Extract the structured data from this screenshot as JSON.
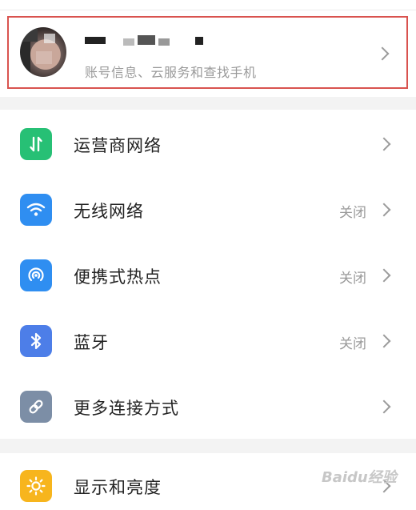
{
  "account": {
    "subtitle": "账号信息、云服务和查找手机"
  },
  "settings": [
    {
      "label": "运营商网络",
      "status": "",
      "icon": "mobile-data-icon",
      "color": "#27c075"
    },
    {
      "label": "无线网络",
      "status": "关闭",
      "icon": "wifi-icon",
      "color": "#2f8ef1"
    },
    {
      "label": "便携式热点",
      "status": "关闭",
      "icon": "hotspot-icon",
      "color": "#2f8ef1"
    },
    {
      "label": "蓝牙",
      "status": "关闭",
      "icon": "bluetooth-icon",
      "color": "#4d7ee8"
    },
    {
      "label": "更多连接方式",
      "status": "",
      "icon": "link-icon",
      "color": "#7c8ea6"
    },
    {
      "label": "显示和亮度",
      "status": "",
      "icon": "brightness-icon",
      "color": "#f7b51d"
    }
  ],
  "watermark": "Baidu经验"
}
